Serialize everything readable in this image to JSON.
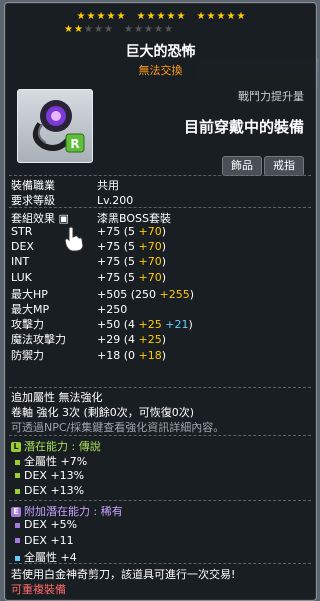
{
  "stars": {
    "row1": [
      true,
      true,
      true,
      true,
      true,
      true,
      true,
      true,
      true,
      true,
      true,
      true,
      true,
      true,
      true
    ],
    "row2": [
      true,
      true,
      false,
      false,
      false,
      false,
      false,
      false,
      false,
      false
    ]
  },
  "item": {
    "name": "巨大的恐怖",
    "trade_status": "無法交換",
    "power_label": "戰鬥力提升量",
    "equipped_text": "目前穿戴中的裝備",
    "tab_jewel": "飾品",
    "tab_ring": "戒指"
  },
  "info": {
    "job_label": "裝備職業",
    "job_value": "共用",
    "req_label": "要求等級",
    "req_value": "Lv.200",
    "set_label": "套組效果",
    "set_value": "漆黑BOSS套裝"
  },
  "stats": [
    {
      "name": "STR",
      "base": "+75",
      "detail": "(5 ",
      "bonus": "+70",
      "close": ")"
    },
    {
      "name": "DEX",
      "base": "+75",
      "detail": "(5 ",
      "bonus": "+70",
      "close": ")"
    },
    {
      "name": "INT",
      "base": "+75",
      "detail": "(5 ",
      "bonus": "+70",
      "close": ")"
    },
    {
      "name": "LUK",
      "base": "+75",
      "detail": "(5 ",
      "bonus": "+70",
      "close": ")"
    },
    {
      "name": "最大HP",
      "base": "+505",
      "detail": "(250 ",
      "bonus": "+255",
      "close": ")"
    },
    {
      "name": "最大MP",
      "base": "+250",
      "detail": "",
      "bonus": "",
      "close": ""
    },
    {
      "name": "攻擊力",
      "base": "+50",
      "detail": "(4 ",
      "bonus": "+25",
      "extra": "+21",
      "close": ")"
    },
    {
      "name": "魔法攻擊力",
      "base": "+29",
      "detail": "(4 ",
      "bonus": "+25",
      "close": ")"
    },
    {
      "name": "防禦力",
      "base": "+18",
      "detail": "(0 ",
      "bonus": "+18",
      "close": ")"
    }
  ],
  "enhance": {
    "line1_label": "追加屬性",
    "line1_value": "無法強化",
    "line2": "卷軸 強化 3次 (剩餘0次，可恢復0次)",
    "line3": "可透過NPC/採集鍵查看強化資訊詳細內容。"
  },
  "potential": {
    "header_label": "潛在能力 :",
    "header_grade": "傳說",
    "badge": "L",
    "lines": [
      "全屬性 +7%",
      "DEX +13%",
      "DEX +13%"
    ]
  },
  "additional": {
    "header_label": "附加潛在能力 :",
    "header_grade": "稀有",
    "badge": "E",
    "lines": [
      "DEX +5%",
      "DEX +11",
      "全屬性 +4"
    ]
  },
  "footer": {
    "line1": "若使用白金神奇剪刀，該道具可進行一次交易!",
    "line2": "可重複裝備"
  }
}
